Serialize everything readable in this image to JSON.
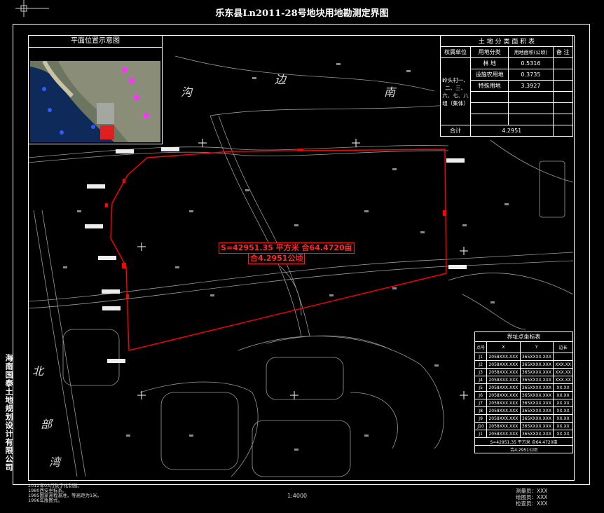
{
  "title": "乐东县Ln2011-28号地块用地勘测定界图",
  "company": "海南国泰土地规划设计有限公司",
  "location_panel": {
    "title": "平面位置示意图"
  },
  "map_words": [
    "沟",
    "边",
    "南",
    "北",
    "部",
    "湾"
  ],
  "parcel_area_label": "S=42951.35 平方米 合64.4720亩",
  "parcel_area_label2": "合4.2951公顷",
  "land_table": {
    "title": "土 地 分 类 面 积 表",
    "headers": [
      "权属单位",
      "用地分类",
      "用地面积(公顷)",
      "备 注"
    ],
    "owner": "岭头村一、二、三、六、七、八组（集体）",
    "rows": [
      {
        "type": "林  地",
        "area": "0.5316"
      },
      {
        "type": "设施农用地",
        "area": "0.3735"
      },
      {
        "type": "特殊用地",
        "area": "3.3927"
      }
    ],
    "total_label": "合计",
    "total_value": "4.2951"
  },
  "coord_table": {
    "title": "界址点坐标表",
    "headers": [
      "点号",
      "X",
      "Y",
      "边长"
    ],
    "rows": [
      {
        "id": "J1",
        "x": "2058XXX.XXX",
        "y": "365XXXX.XXX",
        "len": ""
      },
      {
        "id": "J2",
        "x": "2058XXX.XXX",
        "y": "365XXXX.XXX",
        "len": "XXX.XX"
      },
      {
        "id": "J3",
        "x": "2058XXX.XXX",
        "y": "365XXXX.XXX",
        "len": "XXX.XX"
      },
      {
        "id": "J4",
        "x": "2058XXX.XXX",
        "y": "365XXXX.XXX",
        "len": "XXX.XX"
      },
      {
        "id": "J5",
        "x": "2058XXX.XXX",
        "y": "365XXXX.XXX",
        "len": "XX.XX"
      },
      {
        "id": "J6",
        "x": "2058XXX.XXX",
        "y": "365XXXX.XXX",
        "len": "XX.XX"
      },
      {
        "id": "J7",
        "x": "2058XXX.XXX",
        "y": "365XXXX.XXX",
        "len": "XX.XX"
      },
      {
        "id": "J8",
        "x": "2058XXX.XXX",
        "y": "365XXXX.XXX",
        "len": "XX.XX"
      },
      {
        "id": "J9",
        "x": "2058XXX.XXX",
        "y": "365XXXX.XXX",
        "len": "XX.XX"
      },
      {
        "id": "J10",
        "x": "2058XXX.XXX",
        "y": "365XXXX.XXX",
        "len": "XX.XX"
      },
      {
        "id": "J1",
        "x": "2058XXX.XXX",
        "y": "365XXXX.XXX",
        "len": "XX.XX"
      }
    ],
    "footer1": "S=42951.35 平方米 合64.4720亩",
    "footer2": "合4.2951公顷"
  },
  "footer": {
    "left_lines": [
      "2012年03月数字化制图。",
      "1980西安坐标系。",
      "1985国家高程基准，等高距为1米。",
      "1996年版图式。"
    ],
    "scale": "1:4000",
    "right_lines": [
      "测量员：XXX",
      "绘图员：XXX",
      "检查员：XXX"
    ]
  }
}
